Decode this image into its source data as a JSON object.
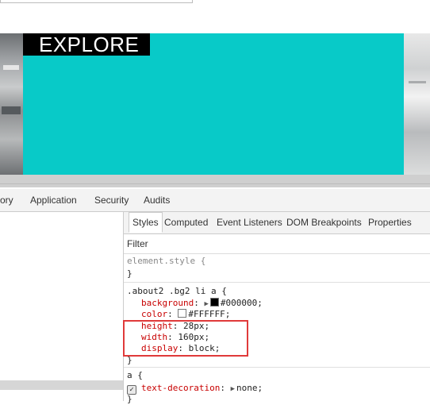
{
  "page": {
    "banner_text": "EXPLORE",
    "colors": {
      "teal": "#08cac8",
      "highlight": "#e03a3a"
    }
  },
  "devtools": {
    "tabs": [
      "ory",
      "Application",
      "Security",
      "Audits"
    ],
    "subtabs": [
      "Styles",
      "Computed",
      "Event Listeners",
      "DOM Breakpoints",
      "Properties"
    ],
    "filter_label": "Filter",
    "rules": {
      "element_style": {
        "selector": "element.style {",
        "close": "}"
      },
      "about": {
        "selector": ".about2 .bg2 li a {",
        "background_prop": "background",
        "background_val": "#000000;",
        "color_prop": "color",
        "color_val": "#FFFFFF;",
        "height_prop": "height",
        "height_val": "28px;",
        "width_prop": "width",
        "width_val": "160px;",
        "display_prop": "display",
        "display_val": "block;",
        "close": "}"
      },
      "anchor": {
        "selector": "a {",
        "prop": "text-decoration",
        "val": "none;",
        "close": "}"
      }
    }
  }
}
